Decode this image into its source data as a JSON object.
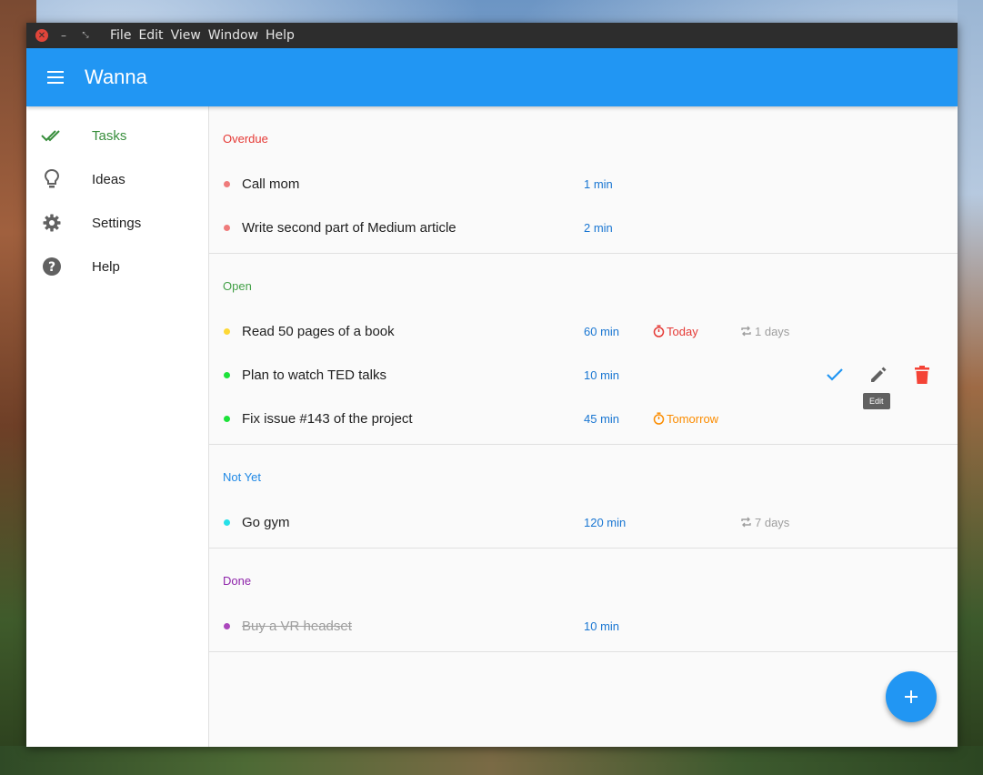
{
  "window": {
    "menu": [
      "File",
      "Edit",
      "View",
      "Window",
      "Help"
    ]
  },
  "app": {
    "title": "Wanna"
  },
  "sidebar": {
    "items": [
      {
        "label": "Tasks",
        "icon": "double-check-icon",
        "active": true
      },
      {
        "label": "Ideas",
        "icon": "lightbulb-icon",
        "active": false
      },
      {
        "label": "Settings",
        "icon": "gear-icon",
        "active": false
      },
      {
        "label": "Help",
        "icon": "help-circle-icon",
        "active": false
      }
    ]
  },
  "sections": {
    "overdue": {
      "title": "Overdue",
      "color": "#e53935",
      "tasks": [
        {
          "text": "Call mom",
          "duration": "1 min",
          "dot": "#ef7b7b"
        },
        {
          "text": "Write second part of Medium article",
          "duration": "2 min",
          "dot": "#ef7b7b"
        }
      ]
    },
    "open": {
      "title": "Open",
      "color": "#43a047",
      "tasks": [
        {
          "text": "Read 50 pages of a book",
          "duration": "60 min",
          "due": "Today",
          "due_color": "#e53935",
          "repeat": "1 days",
          "dot": "#fdd835"
        },
        {
          "text": "Plan to watch TED talks",
          "duration": "10 min",
          "dot": "#1de23a"
        },
        {
          "text": "Fix issue #143 of the project",
          "duration": "45 min",
          "due": "Tomorrow",
          "due_color": "#fb8c00",
          "dot": "#1de23a"
        }
      ]
    },
    "notyet": {
      "title": "Not Yet",
      "color": "#1e88e5",
      "tasks": [
        {
          "text": "Go gym",
          "duration": "120 min",
          "repeat": "7 days",
          "dot": "#26e0e8"
        }
      ]
    },
    "done": {
      "title": "Done",
      "color": "#8e24aa",
      "tasks": [
        {
          "text": "Buy a VR headset",
          "duration": "10 min",
          "dot": "#ab47bc"
        }
      ]
    }
  },
  "row_actions": {
    "tooltip": "Edit",
    "icons": [
      "check-icon",
      "edit-icon",
      "delete-icon"
    ]
  },
  "fab": {
    "icon": "plus-icon"
  },
  "colors": {
    "primary": "#2196f3",
    "delete": "#f44336",
    "edit": "#616161"
  }
}
